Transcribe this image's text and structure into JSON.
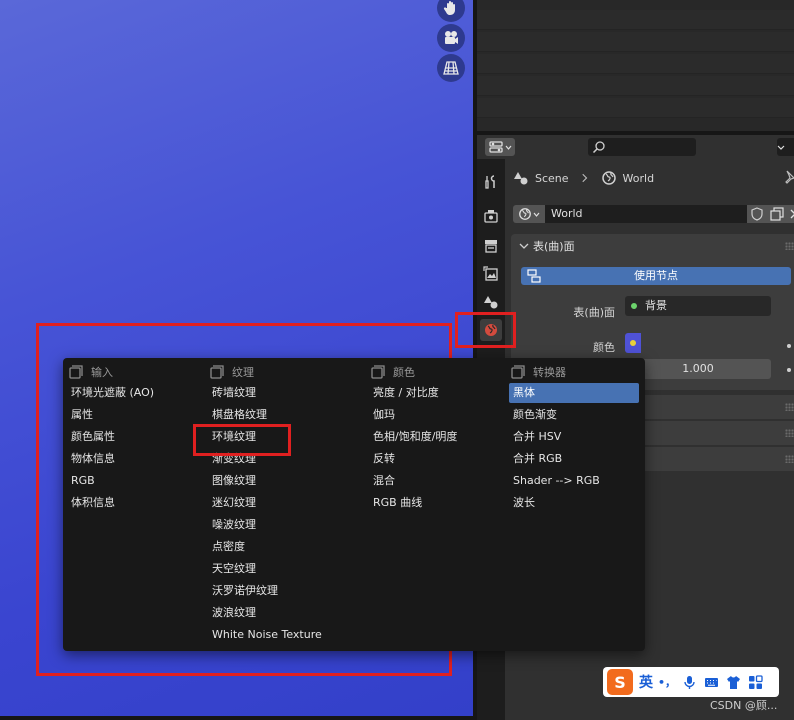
{
  "viewport": {
    "tools": [
      "hand-pan-icon",
      "camera-view-icon",
      "grid-ortho-icon"
    ]
  },
  "properties": {
    "search": {
      "placeholder": ""
    },
    "breadcrumb": {
      "scene": "Scene",
      "world": "World"
    },
    "world_selector": {
      "name": "World"
    },
    "surface_panel": {
      "title": "表(曲)面",
      "use_nodes_label": "使用节点",
      "surface_label": "表(曲)面",
      "surface_value": "背景",
      "color_label": "颜色",
      "strength_value": "1.000"
    },
    "tabs": [
      "tool-icon",
      "render-icon",
      "output-icon",
      "view-layer-icon",
      "scene-icon",
      "world-icon"
    ]
  },
  "add_menu": {
    "columns": [
      {
        "header": "输入",
        "items": [
          "环境光遮蔽 (AO)",
          "属性",
          "颜色属性",
          "物体信息",
          "RGB",
          "体积信息"
        ]
      },
      {
        "header": "纹理",
        "items": [
          "砖墙纹理",
          "棋盘格纹理",
          "环境纹理",
          "渐变纹理",
          "图像纹理",
          "迷幻纹理",
          "噪波纹理",
          "点密度",
          "天空纹理",
          "沃罗诺伊纹理",
          "波浪纹理",
          "White Noise Texture"
        ]
      },
      {
        "header": "颜色",
        "items": [
          "亮度 / 对比度",
          "伽玛",
          "色相/饱和度/明度",
          "反转",
          "混合",
          "RGB 曲线"
        ]
      },
      {
        "header": "转换器",
        "items": [
          "黑体",
          "颜色渐变",
          "合并 HSV",
          "合并 RGB",
          "Shader --> RGB",
          "波长"
        ]
      }
    ],
    "selected_item": "黑体"
  },
  "ime": {
    "lang": "英",
    "punct": "•，"
  },
  "watermark": "CSDN @顾..."
}
